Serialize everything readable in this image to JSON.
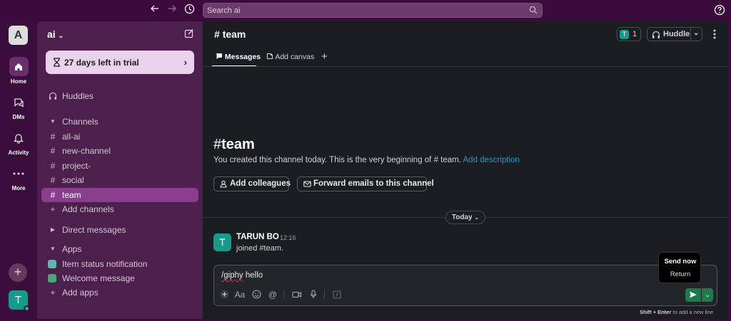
{
  "topbar": {
    "search_placeholder": "Search ai"
  },
  "rail": {
    "workspace_initial": "A",
    "items": [
      {
        "label": "Home",
        "icon": "home-icon",
        "active": true
      },
      {
        "label": "DMs",
        "icon": "dms-icon",
        "active": false
      },
      {
        "label": "Activity",
        "icon": "bell-icon",
        "active": false
      },
      {
        "label": "More",
        "icon": "more-icon",
        "active": false
      }
    ],
    "user_initial": "T"
  },
  "sidebar": {
    "workspace_name": "ai",
    "trial_label": "27 days left in trial",
    "huddles_label": "Huddles",
    "channels_header": "Channels",
    "channels": [
      "all-ai",
      "new-channel",
      "project-",
      "social",
      "team"
    ],
    "active_channel": "team",
    "add_channels_label": "Add channels",
    "dm_header": "Direct messages",
    "apps_header": "Apps",
    "apps": [
      {
        "label": "Item status notification",
        "color": "#5fb9a8"
      },
      {
        "label": "Welcome message",
        "color": "#4aa37a"
      }
    ],
    "add_apps_label": "Add apps"
  },
  "channel": {
    "name": "team",
    "member_initial": "T",
    "member_count": "1",
    "huddle_label": "Huddle",
    "tabs": [
      {
        "label": "Messages",
        "active": true
      },
      {
        "label": "Add canvas",
        "active": false
      }
    ],
    "intro_title": "team",
    "intro_text": "You created this channel today. This is the very beginning of",
    "intro_channel_ref": "# team.",
    "intro_link": "Add description",
    "add_colleagues_label": "Add colleagues",
    "forward_emails_label": "Forward emails to this channel",
    "day_label": "Today"
  },
  "message": {
    "avatar_initial": "T",
    "author": "TARUN BO",
    "time": "12:16",
    "body": "joined #team."
  },
  "composer": {
    "text_cmd": "/giphy",
    "text_rest": " hello",
    "tooltip_title": "Send now",
    "tooltip_key": "Return",
    "hint_keys": "Shift + Enter",
    "hint_text": "to add a new line"
  },
  "colors": {
    "accent": "#8b3d8e",
    "send": "#1e7a4d",
    "link": "#1d9bd1",
    "avatar": "#189a8a"
  }
}
